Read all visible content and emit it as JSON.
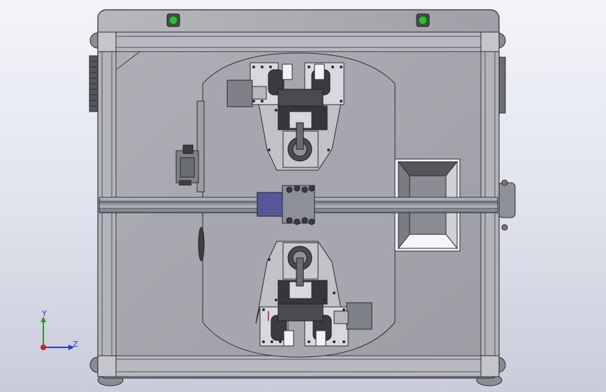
{
  "viewport": {
    "background_top": "#f4f5fa",
    "background_bottom": "#c9ccd9"
  },
  "model": {
    "indicator_lights": [
      {
        "name": "left-indicator-light",
        "color": "#2bbf2b"
      },
      {
        "name": "right-indicator-light",
        "color": "#2bbf2b"
      }
    ],
    "frame_color": "#9a9ba2",
    "plate_color": "#a3a4ab",
    "rail_color": "#8a8d96",
    "clamp_color": "#3a3b40"
  },
  "triad": {
    "y_label": "Y",
    "z_label": "Z",
    "y_color": "#20a020",
    "z_color": "#2040d0",
    "origin_color": "#d02020"
  }
}
